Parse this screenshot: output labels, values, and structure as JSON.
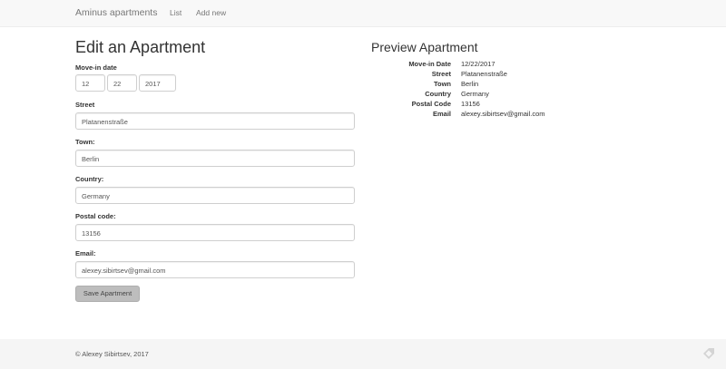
{
  "navbar": {
    "brand": "Aminus apartments",
    "links": [
      "List",
      "Add new"
    ]
  },
  "form": {
    "title": "Edit an Apartment",
    "move_in_label": "Move-in date",
    "move_in": {
      "month": "12",
      "day": "22",
      "year": "2017"
    },
    "street_label": "Street",
    "street": "Platanenstraße",
    "town_label": "Town:",
    "town": "Berlin",
    "country_label": "Country:",
    "country": "Germany",
    "postal_label": "Postal code:",
    "postal": "13156",
    "email_label": "Email:",
    "email": "alexey.sibirtsev@gmail.com",
    "save_label": "Save Apartment"
  },
  "preview": {
    "title": "Preview Apartment",
    "rows": [
      {
        "key": "Move-in Date",
        "value": "12/22/2017"
      },
      {
        "key": "Street",
        "value": "Platanenstraße"
      },
      {
        "key": "Town",
        "value": "Berlin"
      },
      {
        "key": "Country",
        "value": "Germany"
      },
      {
        "key": "Postal Code",
        "value": "13156"
      },
      {
        "key": "Email",
        "value": "alexey.sibirtsev@gmail.com"
      }
    ]
  },
  "footer": {
    "copyright": "© Alexey Sibirtsev, 2017",
    "icon": "tag-icon"
  },
  "colors": {
    "navbar_bg": "#f8f8f8",
    "footer_bg": "#f5f5f5",
    "button_bg": "#bdbdbd"
  }
}
